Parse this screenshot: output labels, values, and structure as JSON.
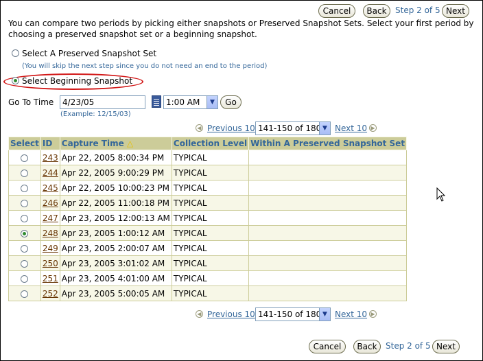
{
  "header": {
    "cancel_label": "Cancel",
    "back_label": "Back",
    "step_text": "Step 2 of 5",
    "next_label": "Next"
  },
  "intro_text": "You can compare two periods by picking either snapshots or Preserved Snapshot Sets. Select your first period by choosing a preserved snapshot set or a beginning snapshot.",
  "options": {
    "preserved_label": "Select A Preserved Snapshot Set",
    "preserved_hint": "(You will skip the next step since you do not need an end to the period)",
    "beginning_label": "Select Beginning Snapshot",
    "selected": "beginning"
  },
  "goto": {
    "label": "Go To Time",
    "date_value": "4/23/05",
    "example": "(Example: 12/15/03)",
    "time_value": "1:00 AM",
    "go_label": "Go"
  },
  "pager": {
    "previous_label": "Previous 10",
    "range_value": "141-150 of 180",
    "next_label": "Next 10"
  },
  "table": {
    "headers": [
      "Select",
      "ID",
      "Capture Time",
      "Collection Level",
      "Within A Preserved Snapshot Set"
    ],
    "sort_icon": "sort-ascending-icon",
    "rows": [
      {
        "id": "243",
        "time": "Apr 22, 2005 8:00:34 PM",
        "level": "TYPICAL",
        "set": "",
        "selected": false
      },
      {
        "id": "244",
        "time": "Apr 22, 2005 9:00:29 PM",
        "level": "TYPICAL",
        "set": "",
        "selected": false
      },
      {
        "id": "245",
        "time": "Apr 22, 2005 10:00:23 PM",
        "level": "TYPICAL",
        "set": "",
        "selected": false
      },
      {
        "id": "246",
        "time": "Apr 22, 2005 11:00:18 PM",
        "level": "TYPICAL",
        "set": "",
        "selected": false
      },
      {
        "id": "247",
        "time": "Apr 23, 2005 12:00:13 AM",
        "level": "TYPICAL",
        "set": "",
        "selected": false
      },
      {
        "id": "248",
        "time": "Apr 23, 2005 1:00:12 AM",
        "level": "TYPICAL",
        "set": "",
        "selected": true
      },
      {
        "id": "249",
        "time": "Apr 23, 2005 2:00:07 AM",
        "level": "TYPICAL",
        "set": "",
        "selected": false
      },
      {
        "id": "250",
        "time": "Apr 23, 2005 3:01:02 AM",
        "level": "TYPICAL",
        "set": "",
        "selected": false
      },
      {
        "id": "251",
        "time": "Apr 23, 2005 4:01:00 AM",
        "level": "TYPICAL",
        "set": "",
        "selected": false
      },
      {
        "id": "252",
        "time": "Apr 23, 2005 5:00:05 AM",
        "level": "TYPICAL",
        "set": "",
        "selected": false
      }
    ]
  },
  "footer": {
    "cancel_label": "Cancel",
    "back_label": "Back",
    "step_text": "Step 2 of 5",
    "next_label": "Next"
  },
  "colors": {
    "accent": "#336699",
    "table_header_bg": "#cccc99",
    "highlight_oval": "#d21818",
    "link": "#663300"
  }
}
